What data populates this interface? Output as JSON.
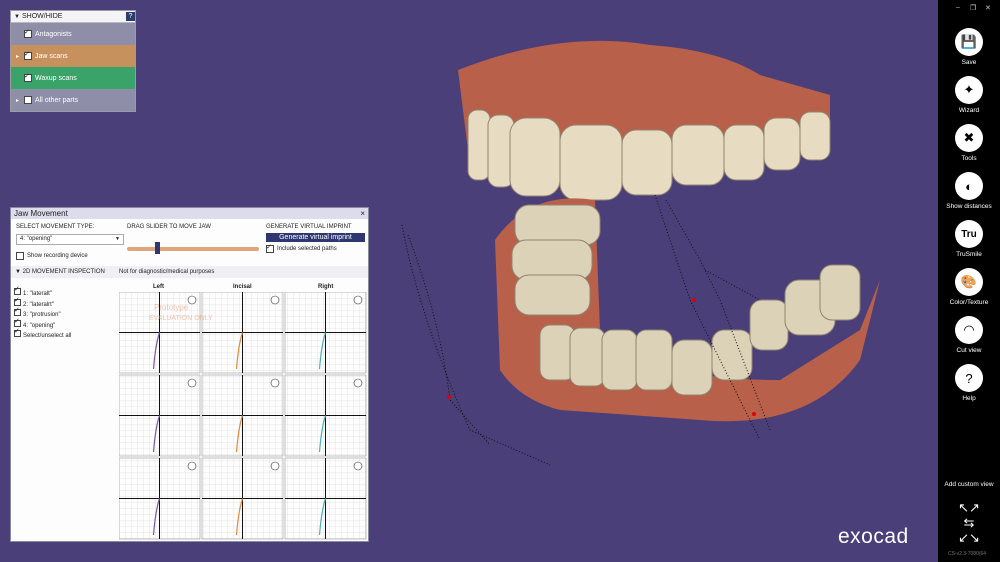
{
  "show_hide": {
    "title": "SHOW/HIDE",
    "help": "?",
    "items": [
      {
        "label": "Antagonists",
        "checked": true,
        "expander": false,
        "color": "#8e8ea8"
      },
      {
        "label": "Jaw scans",
        "checked": true,
        "expander": true,
        "color": "#c7915e"
      },
      {
        "label": "Waxup scans",
        "checked": true,
        "expander": false,
        "color": "#3aa36a"
      },
      {
        "label": "All other parts",
        "checked": false,
        "expander": true,
        "color": "#8e8ea8"
      }
    ]
  },
  "jaw_movement": {
    "title": "Jaw Movement",
    "close": "×",
    "select_type_label": "SELECT MOVEMENT TYPE:",
    "select_value": "4: \"opening\"",
    "show_recording_label": "Show recording device",
    "drag_slider_label": "DRAG SLIDER TO MOVE JAW",
    "slider_position": 0.25,
    "generate_label": "GENERATE VIRTUAL IMPRINT",
    "generate_button": "Generate virtual imprint",
    "include_paths_label": "Include selected paths",
    "inspection_label": "2D MOVEMENT INSPECTION",
    "disclaimer": "Not for diagnostic/medical purposes",
    "movements": [
      "1: \"lateralt\"",
      "2: \"lateralrt\"",
      "3: \"protrusion\"",
      "4: \"opening\"",
      "Select/unselect all"
    ],
    "columns": [
      "Left",
      "Incisal",
      "Right"
    ],
    "watermark_line1": "Prototype",
    "watermark_line2": "EVALUATION ONLY"
  },
  "toolbar": {
    "items": [
      {
        "label": "Save",
        "icon": "save-icon",
        "glyph": "💾"
      },
      {
        "label": "Wizard",
        "icon": "wizard-icon",
        "glyph": "✦"
      },
      {
        "label": "Tools",
        "icon": "tools-icon",
        "glyph": "✖"
      },
      {
        "label": "Show distances",
        "icon": "distances-icon",
        "glyph": "◐"
      },
      {
        "label": "TruSmile",
        "icon": "trusmile-icon",
        "glyph": "Tru"
      },
      {
        "label": "Color/Texture",
        "icon": "palette-icon",
        "glyph": "🎨"
      },
      {
        "label": "Cut view",
        "icon": "cut-view-icon",
        "glyph": "◠"
      },
      {
        "label": "Help",
        "icon": "help-icon",
        "glyph": "?"
      }
    ],
    "add_custom_view": "Add custom view"
  },
  "window": {
    "minimize": "–",
    "restore": "❐",
    "close": "✕"
  },
  "brand": {
    "logo": "exocad",
    "version": "CS-v2.3-7080(64"
  },
  "colors": {
    "background": "#4b3f7a",
    "accent": "#2f3770"
  }
}
